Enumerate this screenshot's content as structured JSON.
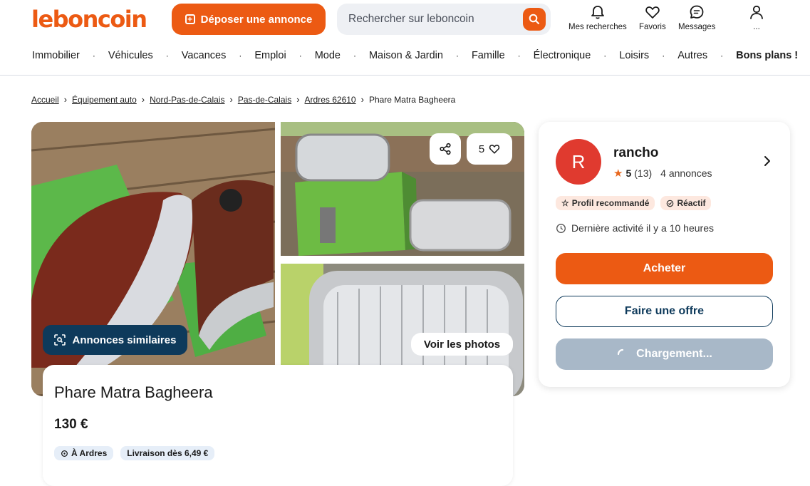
{
  "header": {
    "logo": "leboncoin",
    "deposit_label": "Déposer une annonce",
    "search_placeholder": "Rechercher sur leboncoin",
    "nav": [
      {
        "label": "Mes recherches",
        "icon": "bell-icon"
      },
      {
        "label": "Favoris",
        "icon": "heart-icon"
      },
      {
        "label": "Messages",
        "icon": "chat-icon"
      },
      {
        "label": "...",
        "icon": "user-icon"
      }
    ]
  },
  "categories": [
    "Immobilier",
    "Véhicules",
    "Vacances",
    "Emploi",
    "Mode",
    "Maison & Jardin",
    "Famille",
    "Électronique",
    "Loisirs",
    "Autres",
    "Bons plans !"
  ],
  "breadcrumb": {
    "links": [
      "Accueil",
      "Équipement auto",
      "Nord-Pas-de-Calais",
      "Pas-de-Calais",
      "Ardres 62610"
    ],
    "current": "Phare Matra Bagheera"
  },
  "gallery": {
    "similar_label": "Annonces similaires",
    "view_photos_label": "Voir les photos",
    "favorites_count": "5"
  },
  "ad": {
    "title": "Phare Matra Bagheera",
    "price": "130 €",
    "location": "À Ardres",
    "delivery": "Livraison dès 6,49 €"
  },
  "seller": {
    "initial": "R",
    "name": "rancho",
    "rating": "5",
    "reviews": "(13)",
    "listings": "4 annonces",
    "badge_recommended": "Profil recommandé",
    "badge_reactive": "Réactif",
    "last_activity": "Dernière activité il y a 10 heures",
    "buy_label": "Acheter",
    "offer_label": "Faire une offre",
    "loading_label": "Chargement..."
  },
  "colors": {
    "brand": "#ec5a13",
    "navy": "#0e3a5b",
    "avatar": "#e03a2f"
  }
}
